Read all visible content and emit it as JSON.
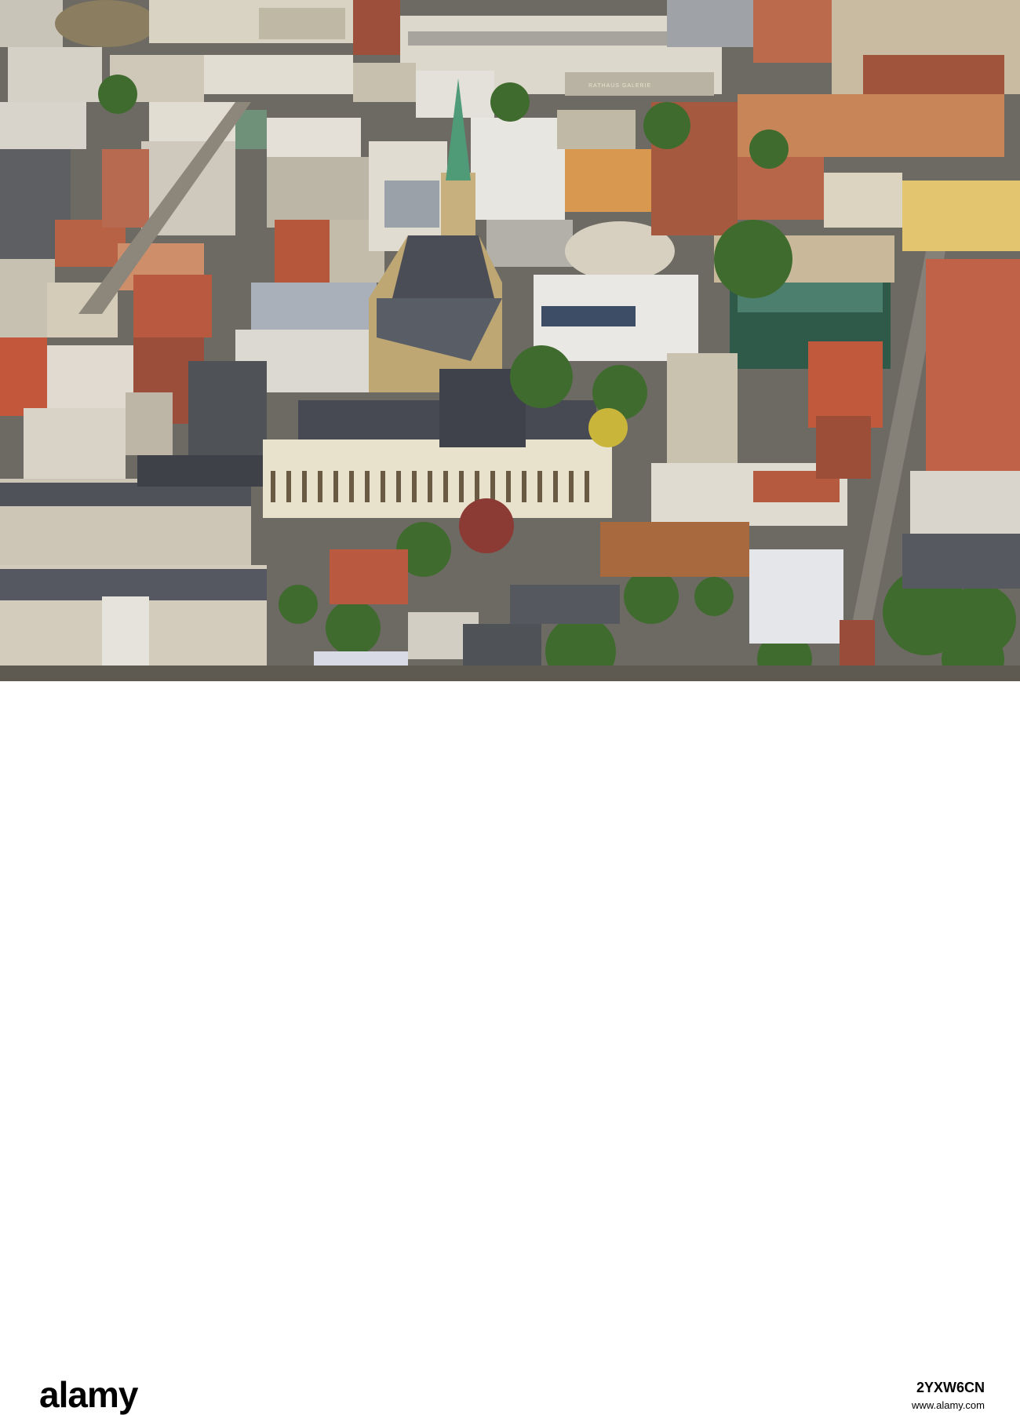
{
  "photo": {
    "description_label": "aerial-city-photo",
    "sign_text": "RATHAUS GALERIE"
  },
  "footer": {
    "logo_text": "alamy",
    "image_id": "2YXW6CN",
    "image_sub": "www.alamy.com"
  },
  "colors": {
    "spire": "#4f9a77",
    "roof_dark": "#4a4d55",
    "roof_red": "#b35a3a",
    "facade_cream": "#e8e1cc",
    "tree_green": "#3f6b2e",
    "glass": "#2f5a4a"
  }
}
